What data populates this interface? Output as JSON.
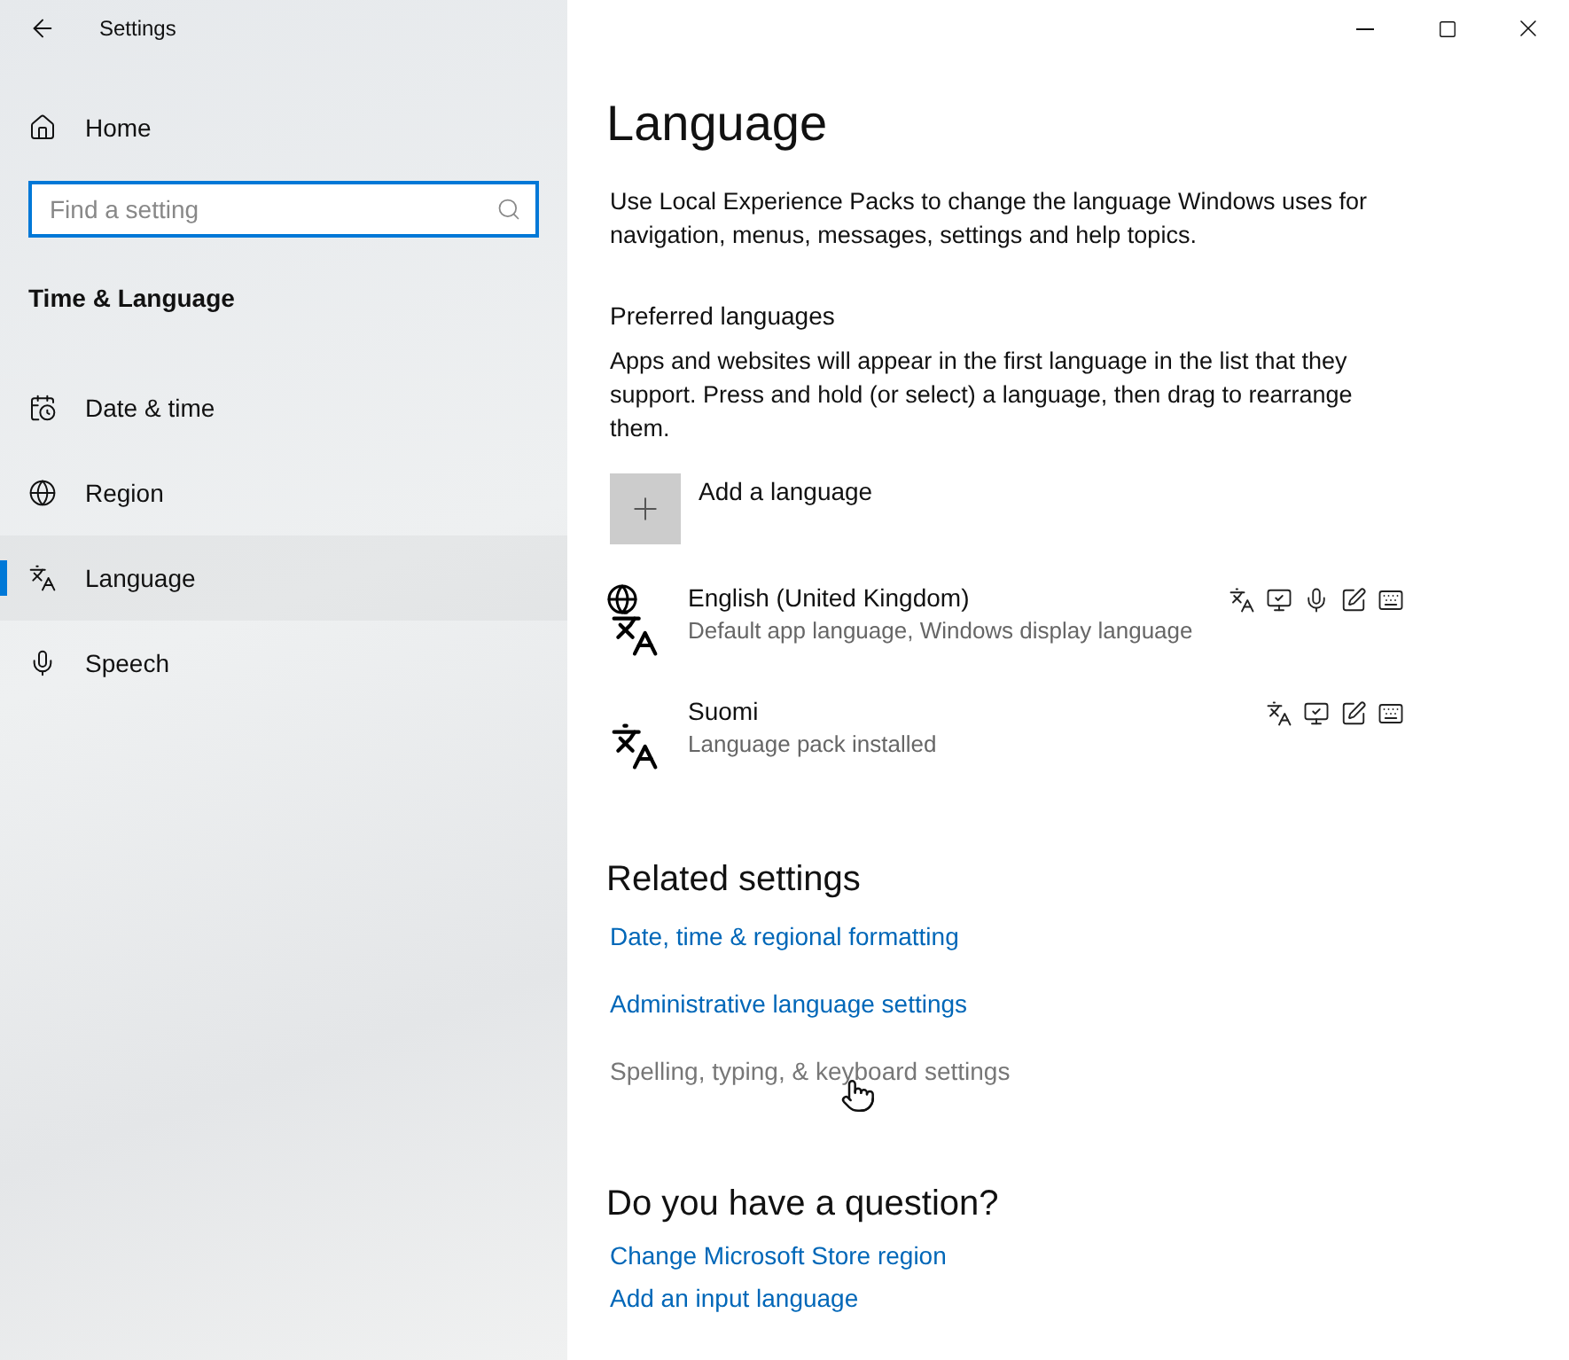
{
  "window": {
    "title": "Settings"
  },
  "sidebar": {
    "home": "Home",
    "search": {
      "placeholder": "Find a setting"
    },
    "section": "Time & Language",
    "items": [
      {
        "label": "Date & time",
        "kind": "calendar",
        "selected": false
      },
      {
        "label": "Region",
        "kind": "globe",
        "selected": false
      },
      {
        "label": "Language",
        "kind": "language",
        "selected": true
      },
      {
        "label": "Speech",
        "kind": "microphone",
        "selected": false
      }
    ]
  },
  "page": {
    "title": "Language",
    "intro": "Use Local Experience Packs to change the language Windows uses for navigation, menus, messages, settings and help topics.",
    "preferred": {
      "heading": "Preferred languages",
      "description": "Apps and websites will appear in the first language in the list that they support. Press and hold (or select) a language, then drag to rearrange them.",
      "add": "Add a language",
      "languages": [
        {
          "name": "English (United Kingdom)",
          "status": "Default app language, Windows display language",
          "display": true,
          "features": [
            {
              "kind": "text"
            },
            {
              "kind": "display"
            },
            {
              "kind": "speech"
            },
            {
              "kind": "handwriting"
            },
            {
              "kind": "keyboard"
            }
          ]
        },
        {
          "name": "Suomi",
          "status": "Language pack installed",
          "display": false,
          "features": [
            {
              "kind": "text"
            },
            {
              "kind": "display"
            },
            {
              "kind": "handwriting"
            },
            {
              "kind": "keyboard"
            }
          ]
        }
      ]
    },
    "related": {
      "heading": "Related settings",
      "links": [
        {
          "label": "Date, time & regional formatting",
          "hovered": false
        },
        {
          "label": "Administrative language settings",
          "hovered": false
        },
        {
          "label": "Spelling, typing, & keyboard settings",
          "hovered": true
        }
      ]
    },
    "question": {
      "heading": "Do you have a question?",
      "links": [
        {
          "label": "Change Microsoft Store region",
          "hovered": false
        },
        {
          "label": "Add an input language",
          "hovered": false
        }
      ]
    }
  }
}
